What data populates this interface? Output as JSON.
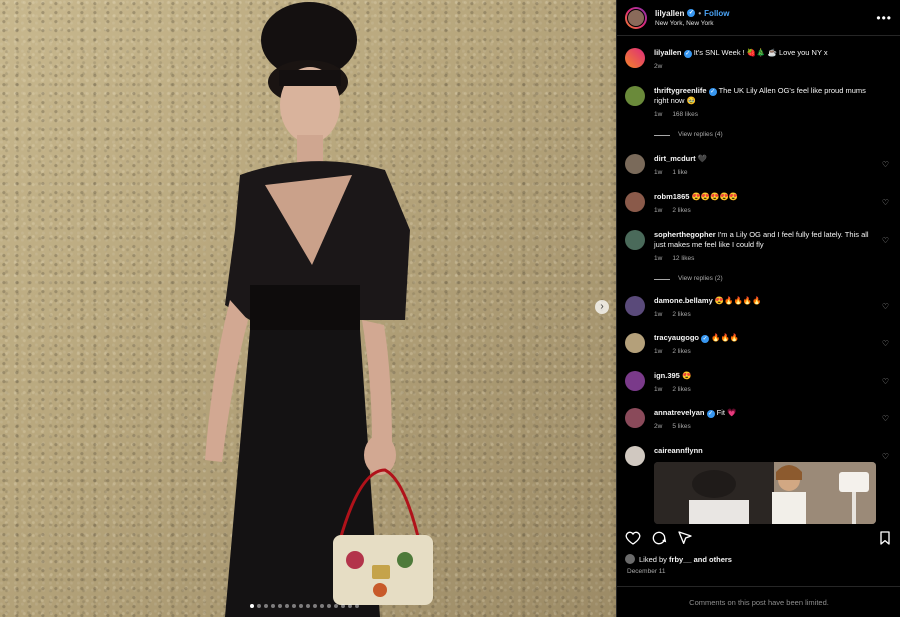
{
  "post": {
    "username": "lilyallen",
    "follow_label": "Follow",
    "location": "New York, New York",
    "more_label": "•••",
    "caption": {
      "username": "lilyallen",
      "text": "It's SNL Week ! 🍓🎄 ☕ Love you NY x",
      "time": "2w"
    }
  },
  "comments": [
    {
      "username": "thriftygreenlife",
      "text": "The UK Lily Allen OG's feel like proud mums right now 🥹",
      "time": "1w",
      "likes": "168 likes",
      "replies": "View replies (4)",
      "avatar_color": "#6a8a3a"
    },
    {
      "username": "dirt_mcdurt",
      "text": "🖤",
      "time": "1w",
      "likes": "1 like",
      "avatar_color": "#7a6a5a"
    },
    {
      "username": "robm1865",
      "text": "😍😍😍😍😍",
      "time": "1w",
      "likes": "2 likes",
      "avatar_color": "#8a5a4a"
    },
    {
      "username": "sopherthegopher",
      "text": "I'm a Lily OG and I feel fully fed lately. This all just makes me feel like I could fly",
      "time": "1w",
      "likes": "12 likes",
      "replies": "View replies (2)",
      "avatar_color": "#4a6a5a"
    },
    {
      "username": "damone.bellamy",
      "text": "😍🔥🔥🔥🔥",
      "time": "1w",
      "likes": "2 likes",
      "avatar_color": "#5a4a7a"
    },
    {
      "username": "tracyaugogo",
      "text": "🔥🔥🔥",
      "time": "1w",
      "likes": "2 likes",
      "avatar_color": "#b4a07a"
    },
    {
      "username": "ign.395",
      "text": "😍",
      "time": "1w",
      "likes": "2 likes",
      "avatar_color": "#7a3a8a"
    },
    {
      "username": "annatrevelyan",
      "text": "Fit 💗",
      "time": "2w",
      "likes": "5 likes",
      "avatar_color": "#8a4a5a"
    },
    {
      "username": "caireannflynn",
      "text": "",
      "time": "",
      "likes": "",
      "avatar_color": "#d0c8c0"
    }
  ],
  "footer": {
    "liked_by_prefix": "Liked by",
    "liked_by_user": "frby__",
    "liked_by_suffix": "and others",
    "date": "December 11",
    "limited_note": "Comments on this post have been limited."
  },
  "carousel": {
    "total_dots": 16,
    "active_index": 0
  },
  "colors": {
    "accent": "#4aa3f5",
    "verified": "#3897f0",
    "muted": "#a8a8a8"
  }
}
